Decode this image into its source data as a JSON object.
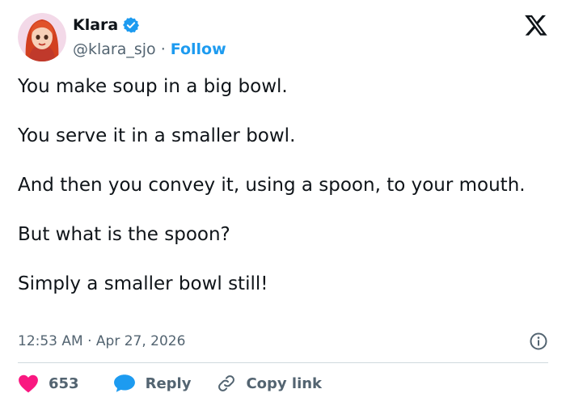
{
  "author": {
    "display_name": "Klara",
    "handle": "@klara_sjo",
    "separator": "·",
    "follow_label": "Follow",
    "avatar_icon": "avatar-red-hair-girl",
    "verified_icon": "verified-badge-icon"
  },
  "platform_icon": "x-logo-icon",
  "tweet": {
    "paragraphs": [
      "You make soup in a big bowl.",
      "You serve it in a smaller bowl.",
      "And then you convey it, using a spoon, to your mouth.",
      "But what is the spoon?",
      "Simply a smaller bowl still!"
    ],
    "timestamp": "12:53 AM · Apr 27, 2026"
  },
  "actions": {
    "like_count": "653",
    "reply_label": "Reply",
    "copy_link_label": "Copy link"
  },
  "colors": {
    "text": "#0f1419",
    "muted": "#536471",
    "accent": "#1d9bf0",
    "like": "#f91880",
    "divider": "#cfd9de"
  }
}
